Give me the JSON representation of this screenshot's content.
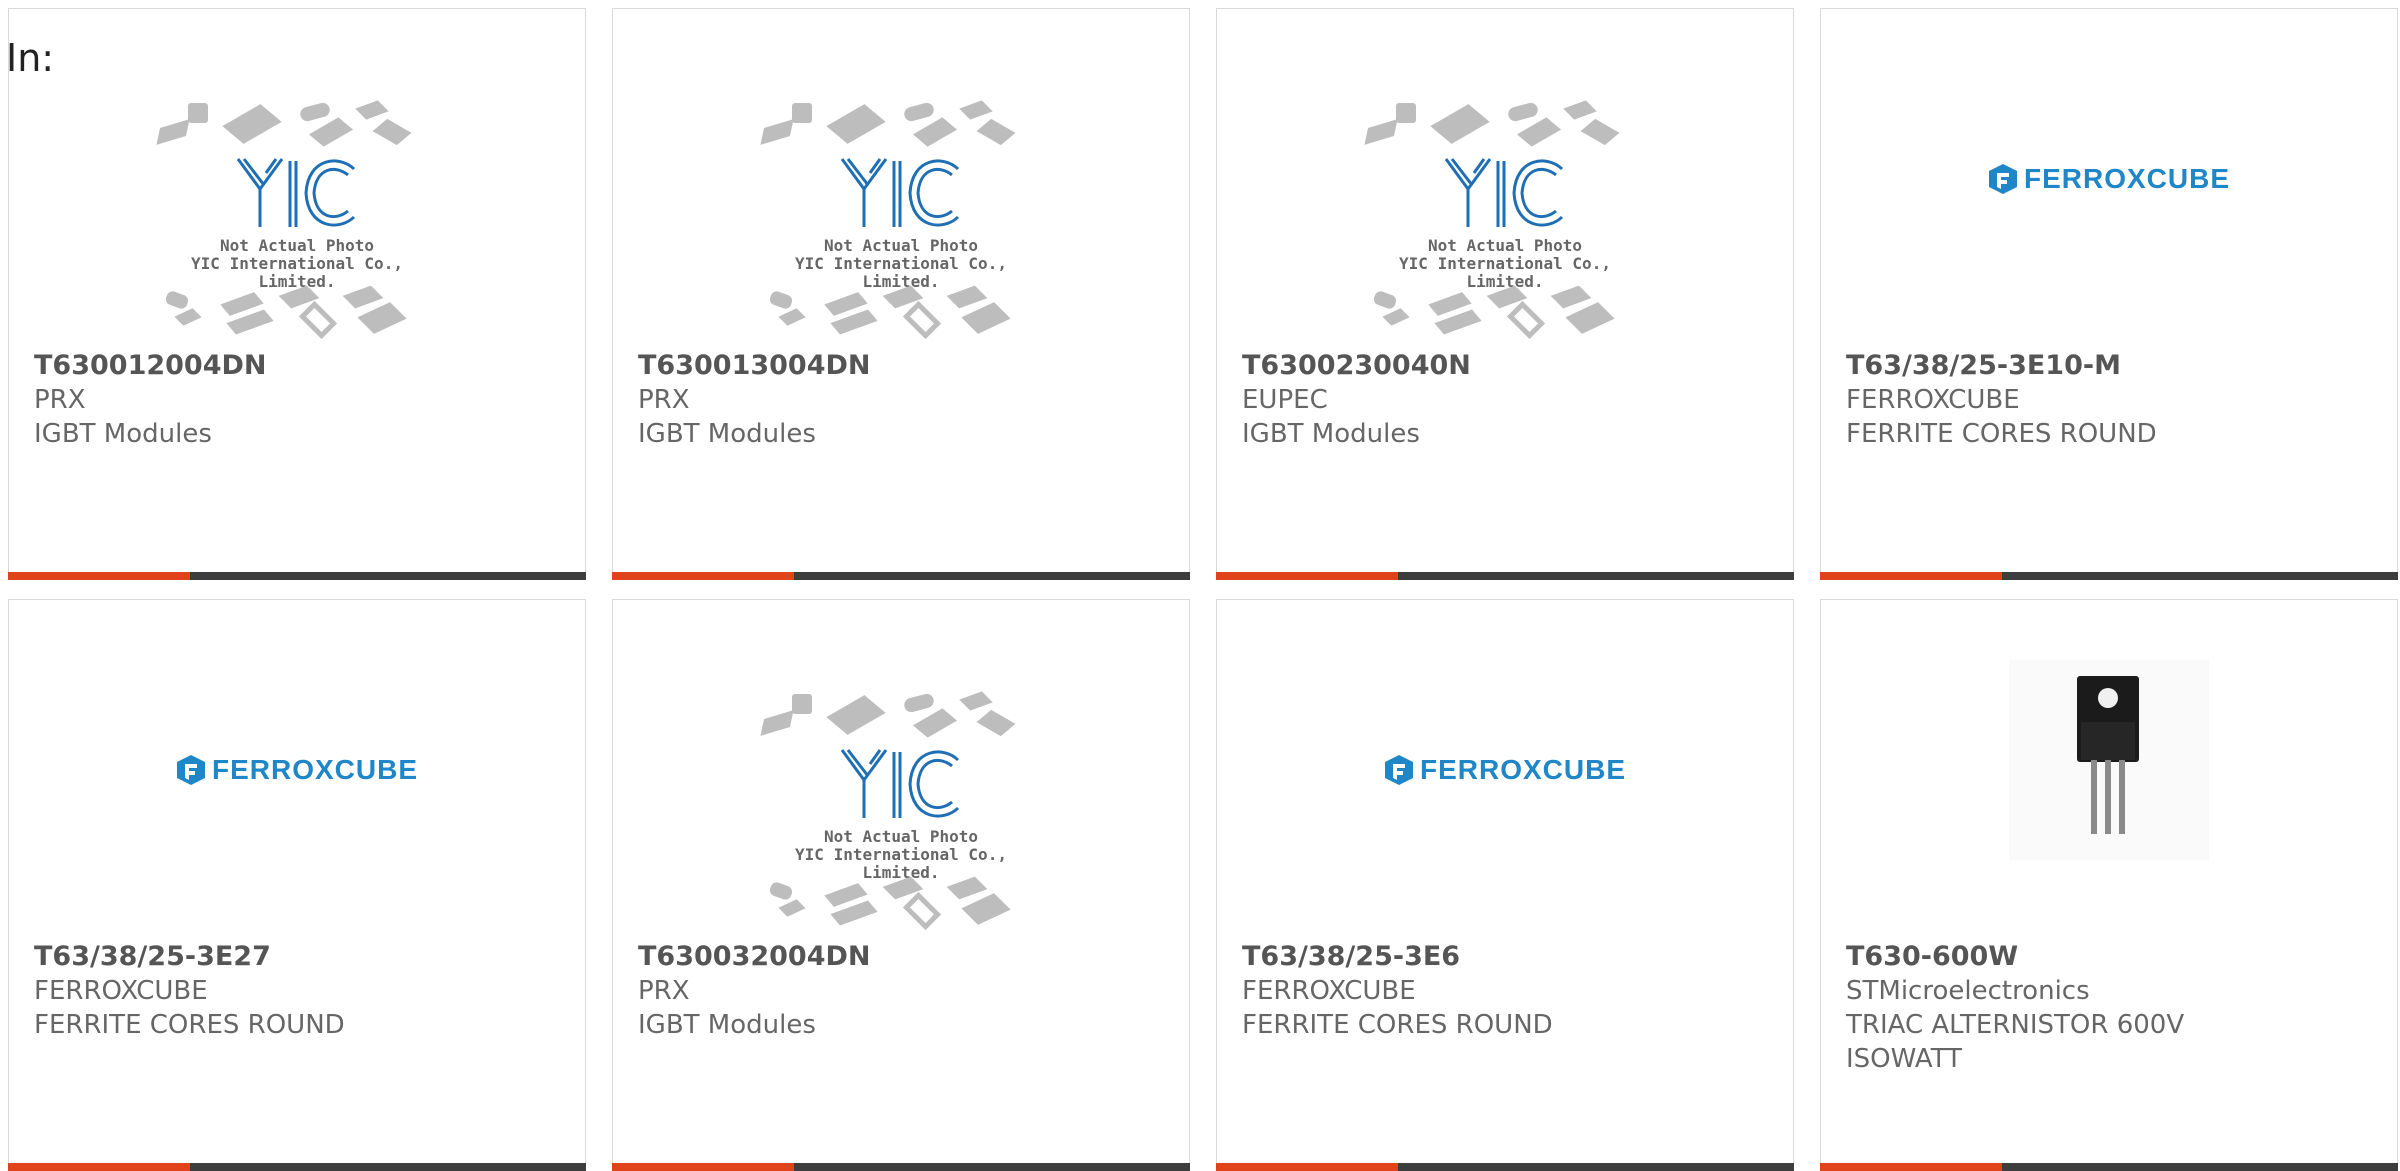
{
  "header": {
    "in_label": "In:"
  },
  "placeholder": {
    "line1": "Not Actual Photo",
    "line2": "YIC International Co., Limited."
  },
  "brand": {
    "ferroxcube_logo": "FERROXCUBE",
    "accent": "#e0421a",
    "bar": "#3d3d3d",
    "logo_blue": "#1f86c7"
  },
  "products": [
    {
      "part": "T630012004DN",
      "maker": "PRX",
      "desc": "IGBT Modules",
      "image": "yic-placeholder"
    },
    {
      "part": "T630013004DN",
      "maker": "PRX",
      "desc": "IGBT Modules",
      "image": "yic-placeholder"
    },
    {
      "part": "T6300230040N",
      "maker": "EUPEC",
      "desc": "IGBT Modules",
      "image": "yic-placeholder"
    },
    {
      "part": "T63/38/25-3E10-M",
      "maker": "FERROXCUBE",
      "desc": "FERRITE CORES ROUND",
      "image": "ferroxcube-logo"
    },
    {
      "part": "T63/38/25-3E27",
      "maker": "FERROXCUBE",
      "desc": "FERRITE CORES ROUND",
      "image": "ferroxcube-logo"
    },
    {
      "part": "T630032004DN",
      "maker": "PRX",
      "desc": "IGBT Modules",
      "image": "yic-placeholder"
    },
    {
      "part": "T63/38/25-3E6",
      "maker": "FERROXCUBE",
      "desc": "FERRITE CORES ROUND",
      "image": "ferroxcube-logo"
    },
    {
      "part": "T630-600W",
      "maker": "STMicroelectronics",
      "desc": "TRIAC ALTERNISTOR 600V ISOWATT",
      "image": "to220-photo"
    }
  ]
}
